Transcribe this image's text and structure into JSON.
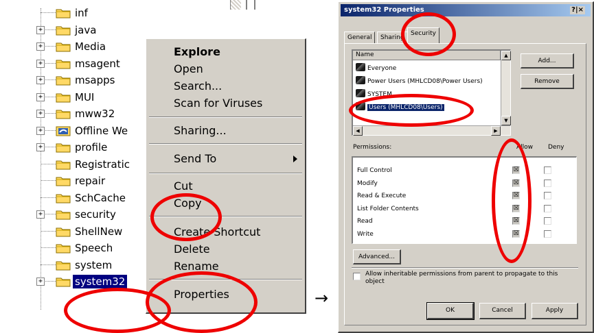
{
  "tree": {
    "items": [
      {
        "label": "inf",
        "expandable": false
      },
      {
        "label": "java",
        "expandable": true
      },
      {
        "label": "Media",
        "expandable": true
      },
      {
        "label": "msagent",
        "expandable": true
      },
      {
        "label": "msapps",
        "expandable": true
      },
      {
        "label": "MUI",
        "expandable": true
      },
      {
        "label": "mww32",
        "expandable": true
      },
      {
        "label": "Offline We",
        "expandable": true,
        "special": true
      },
      {
        "label": "profile",
        "expandable": true
      },
      {
        "label": "Registratic",
        "expandable": false
      },
      {
        "label": "repair",
        "expandable": false
      },
      {
        "label": "SchCache",
        "expandable": false
      },
      {
        "label": "security",
        "expandable": true
      },
      {
        "label": "ShellNew",
        "expandable": false
      },
      {
        "label": "Speech",
        "expandable": false
      },
      {
        "label": "system",
        "expandable": false
      },
      {
        "label": "system32",
        "expandable": true,
        "selected": true
      }
    ],
    "expander_glyph": "+"
  },
  "context_menu": {
    "explore": "Explore",
    "open": "Open",
    "search": "Search...",
    "scan": "Scan for Viruses",
    "sharing": "Sharing...",
    "send_to": "Send To",
    "cut": "Cut",
    "copy": "Copy",
    "create_shortcut": "Create Shortcut",
    "delete": "Delete",
    "rename": "Rename",
    "properties": "Properties"
  },
  "arrow": "→",
  "dialog": {
    "title": "system32 Properties",
    "title_buttons": "?|×",
    "tabs": {
      "general": "General",
      "sharing": "Sharing",
      "security": "Security"
    },
    "name_header": "Name",
    "users": [
      {
        "name": "Everyone"
      },
      {
        "name": "Power Users (MHLCD08\\Power Users)"
      },
      {
        "name": "SYSTEM"
      },
      {
        "name": "Users (MHLCD08\\Users)",
        "selected": true
      }
    ],
    "add_button": "Add...",
    "remove_button": "Remove",
    "permissions_label": "Permissions:",
    "allow_label": "Allow",
    "deny_label": "Deny",
    "permissions": [
      {
        "name": "Full Control",
        "allow": true,
        "deny": false
      },
      {
        "name": "Modify",
        "allow": true,
        "deny": false
      },
      {
        "name": "Read & Execute",
        "allow": true,
        "deny": false
      },
      {
        "name": "List Folder Contents",
        "allow": true,
        "deny": false
      },
      {
        "name": "Read",
        "allow": true,
        "deny": false
      },
      {
        "name": "Write",
        "allow": true,
        "deny": false
      }
    ],
    "advanced_button": "Advanced...",
    "inherit_text": "Allow inheritable permissions from parent to propagate to this object",
    "ok_button": "OK",
    "cancel_button": "Cancel",
    "apply_button": "Apply",
    "check_glyph": "☒"
  },
  "colors": {
    "highlight_ring": "#ee0000",
    "selection": "#000080",
    "dialog_face": "#d4d0c8"
  }
}
